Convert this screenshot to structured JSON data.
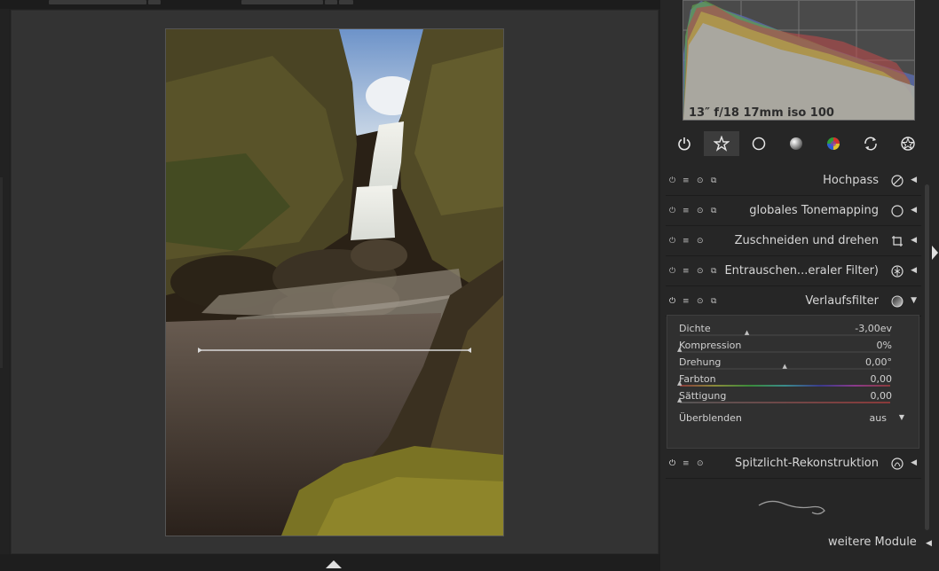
{
  "histogram": {
    "exif_info": "13″ f/18 17mm iso 100"
  },
  "module_groups": [
    {
      "icon": "power-icon",
      "active": false
    },
    {
      "icon": "star-icon",
      "active": true
    },
    {
      "icon": "circle-icon",
      "active": false
    },
    {
      "icon": "tone-icon",
      "active": false
    },
    {
      "icon": "color-icon",
      "active": false
    },
    {
      "icon": "correct-icon",
      "active": false
    },
    {
      "icon": "effect-icon",
      "active": false
    }
  ],
  "modules": [
    {
      "name": "Hochpass",
      "enabled": false,
      "expanded": false
    },
    {
      "name": "globales Tonemapping",
      "enabled": false,
      "expanded": false
    },
    {
      "name": "Zuschneiden und drehen",
      "enabled": false,
      "expanded": false
    },
    {
      "name": "Entrauschen...eraler Filter)",
      "enabled": false,
      "expanded": false
    },
    {
      "name": "Verlaufsfilter",
      "enabled": true,
      "expanded": true
    },
    {
      "name": "Spitzlicht-Rekonstruktion",
      "enabled": true,
      "expanded": false
    }
  ],
  "verlaufsfilter": {
    "density": {
      "label": "Dichte",
      "value": "-3,00ev",
      "position": 0.32
    },
    "hardness": {
      "label": "Kompression",
      "value": "0%",
      "position": 0.0
    },
    "rotation": {
      "label": "Drehung",
      "value": "0,00°",
      "position": 0.5
    },
    "hue": {
      "label": "Farbton",
      "value": "0,00",
      "position": 0.0
    },
    "saturation": {
      "label": "Sättigung",
      "value": "0,00",
      "position": 0.0
    },
    "blend": {
      "label": "Überblenden",
      "value": "aus"
    }
  },
  "footer": {
    "more_modules": "weitere Module"
  },
  "colors": {
    "panel_bg": "#262626",
    "center_bg": "#333333",
    "text": "#d6d6d6"
  }
}
